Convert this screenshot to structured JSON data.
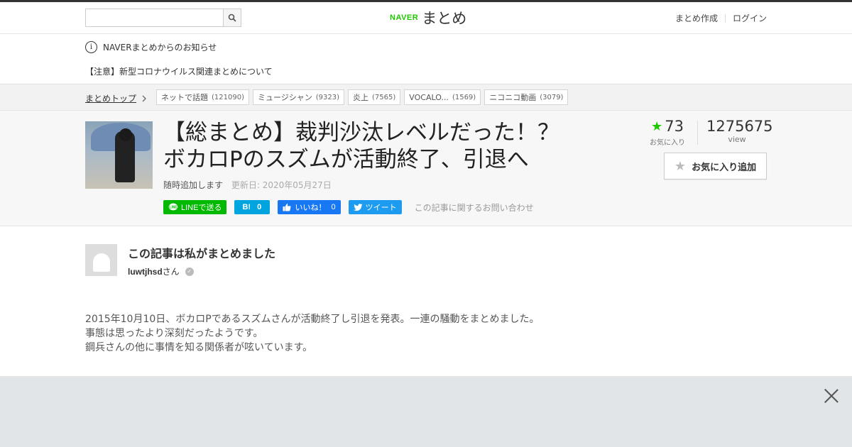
{
  "header": {
    "search_placeholder": "",
    "logo_brand": "NAVER",
    "logo_name": "まとめ",
    "links": [
      "まとめ作成",
      "ログイン"
    ]
  },
  "notices": {
    "title": "NAVERまとめからのお知らせ",
    "item": "【注意】新型コロナウイルス関連まとめについて"
  },
  "breadcrumb": {
    "top": "まとめトップ",
    "tags": [
      {
        "label": "ネットで話題",
        "count": "(121090)"
      },
      {
        "label": "ミュージシャン",
        "count": "(9323)"
      },
      {
        "label": "炎上",
        "count": "(7565)"
      },
      {
        "label": "VOCALO...",
        "count": "(1569)"
      },
      {
        "label": "ニコニコ動画",
        "count": "(3079)"
      }
    ]
  },
  "article": {
    "title_line1": "【総まとめ】裁判沙汰レベルだった！？",
    "title_line2": "ボカロPのスズムが活動終了、引退へ",
    "status": "随時追加します",
    "updated": "更新日: 2020年05月27日",
    "favorites": "73",
    "favorites_label": "お気に入り",
    "views": "1275675",
    "views_label": "view",
    "fav_button": "お気に入り追加"
  },
  "share": {
    "line": "LINEで送る",
    "hatena_icon": "B!",
    "hatena_count": "0",
    "fb_label": "いいね！",
    "fb_count": "0",
    "tweet": "ツイート",
    "contact": "この記事に関するお問い合わせ"
  },
  "author": {
    "heading": "この記事は私がまとめました",
    "name": "luwtjhsd",
    "suffix": "さん"
  },
  "description": [
    "2015年10月10日、ボカロPであるスズムさんが活動終了し引退を発表。一連の騒動をまとめました。",
    "事態は思ったより深刻だったようです。",
    "鋼兵さんの他に事情を知る関係者が呟いています。"
  ],
  "colors": {
    "accent": "#1ec800",
    "line": "#00b900",
    "hatena": "#00a4de",
    "facebook": "#1877f2",
    "twitter": "#1d9bf0"
  }
}
